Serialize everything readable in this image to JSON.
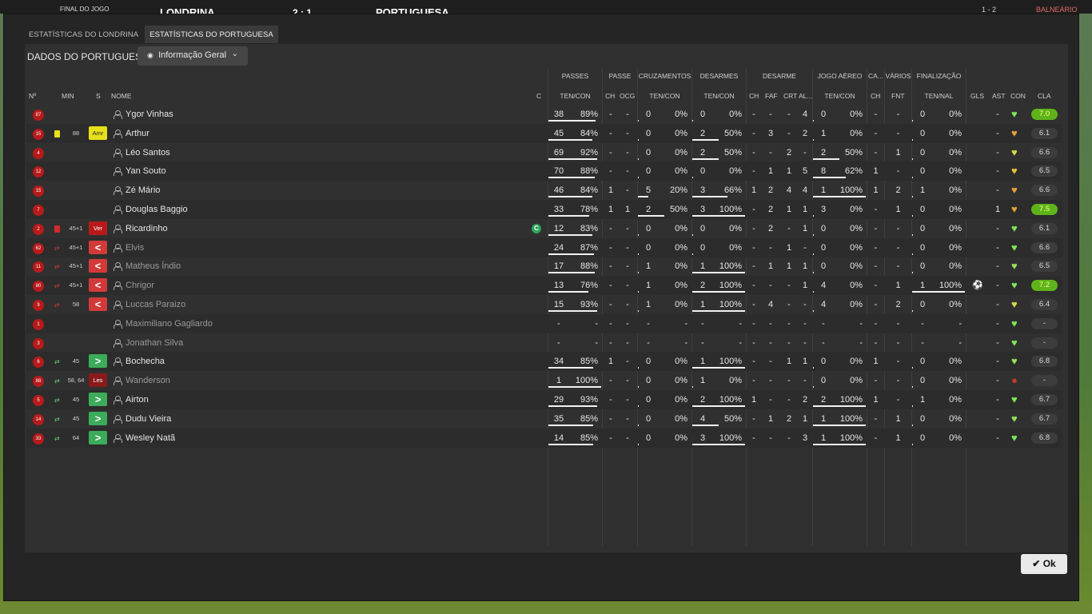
{
  "scorebar": {
    "status": "FINAL DO JOGO",
    "home": "LONDRINA",
    "score": "2 : 1",
    "away": "PORTUGUESA",
    "right1": "1 - 2",
    "right2": "BALNEÁRIO"
  },
  "tabs": [
    {
      "label": "ESTATÍSTICAS DO LONDRINA",
      "active": false
    },
    {
      "label": "ESTATÍSTICAS DO PORTUGUESA",
      "active": true
    }
  ],
  "header": {
    "title": "DADOS DO PORTUGUESA",
    "dropdown": "Informação Geral"
  },
  "groups": {
    "passes": "PASSES",
    "passe": "PASSE",
    "cruz": "CRUZAMENTOS",
    "desarmes": "DESARMES",
    "desarme": "DESARME",
    "jogo": "JOGO AÉREO",
    "ca": "CA...",
    "varios": "VÁRIOS",
    "final": "FINALIZAÇÃO"
  },
  "cols": {
    "no": "Nº",
    "min": "MIN",
    "s": "S",
    "nome": "NOME",
    "c": "C",
    "passes": "TEN/CON",
    "ch1": "CH",
    "ocg": "OCG",
    "cruz": "TEN/CON",
    "des": "TEN/CON",
    "ch2": "CH",
    "faf": "FAF",
    "crt": "CRT",
    "al": "AL...",
    "jogo": "TEN/CON",
    "ch3": "CH",
    "fnt": "FNT",
    "fin": "TEN/NAL",
    "gls": "GLS",
    "ast": "AST",
    "con": "CON",
    "cla": "CLA"
  },
  "captain_mark": "C",
  "players": [
    {
      "no": "87",
      "min": "",
      "s": "",
      "name": "Ygor Vinhas",
      "dim": false,
      "p": [
        "38",
        "89%"
      ],
      "pf": 0.89,
      "ch": "-",
      "ocg": "-",
      "cr": [
        "0",
        "0%"
      ],
      "crf": 0,
      "de": [
        "0",
        "0%"
      ],
      "def": 0,
      "dch": "-",
      "faf": "-",
      "crt": "-",
      "al": "4",
      "ja": [
        "0",
        "0%"
      ],
      "jaf": 0,
      "ca": "-",
      "fnt": "-",
      "fi": [
        "0",
        "0%"
      ],
      "fif": 0,
      "gls": "",
      "ast": "-",
      "con": "#7ee65a",
      "cla": "7.0",
      "claG": true
    },
    {
      "no": "15",
      "min": "88",
      "s": "Amr",
      "sType": "yellow",
      "card": "yellow",
      "name": "Arthur",
      "dim": false,
      "p": [
        "45",
        "84%"
      ],
      "pf": 0.84,
      "ch": "-",
      "ocg": "-",
      "cr": [
        "0",
        "0%"
      ],
      "crf": 0,
      "de": [
        "2",
        "50%"
      ],
      "def": 0.5,
      "dch": "-",
      "faf": "3",
      "crt": "-",
      "al": "2",
      "ja": [
        "1",
        "0%"
      ],
      "jaf": 0,
      "ca": "-",
      "fnt": "-",
      "fi": [
        "0",
        "0%"
      ],
      "fif": 0,
      "gls": "",
      "ast": "-",
      "con": "#e8a23a",
      "cla": "6.1",
      "claG": false
    },
    {
      "no": "4",
      "min": "",
      "s": "",
      "name": "Léo Santos",
      "dim": false,
      "p": [
        "69",
        "92%"
      ],
      "pf": 0.92,
      "ch": "-",
      "ocg": "-",
      "cr": [
        "0",
        "0%"
      ],
      "crf": 0,
      "de": [
        "2",
        "50%"
      ],
      "def": 0.5,
      "dch": "-",
      "faf": "-",
      "crt": "2",
      "al": "-",
      "ja": [
        "2",
        "50%"
      ],
      "jaf": 0.5,
      "ca": "-",
      "fnt": "1",
      "fi": [
        "0",
        "0%"
      ],
      "fif": 0,
      "gls": "",
      "ast": "-",
      "con": "#d8d94a",
      "cla": "6.6",
      "claG": false
    },
    {
      "no": "12",
      "min": "",
      "s": "",
      "name": "Yan Souto",
      "dim": false,
      "p": [
        "70",
        "88%"
      ],
      "pf": 0.88,
      "ch": "-",
      "ocg": "-",
      "cr": [
        "0",
        "0%"
      ],
      "crf": 0,
      "de": [
        "0",
        "0%"
      ],
      "def": 0,
      "dch": "-",
      "faf": "1",
      "crt": "1",
      "al": "5",
      "ja": [
        "8",
        "62%"
      ],
      "jaf": 0.62,
      "ca": "1",
      "fnt": "-",
      "fi": [
        "0",
        "0%"
      ],
      "fif": 0,
      "gls": "",
      "ast": "-",
      "con": "#e8c23a",
      "cla": "6.5",
      "claG": false
    },
    {
      "no": "15",
      "min": "",
      "s": "",
      "name": "Zé Mário",
      "dim": false,
      "p": [
        "46",
        "84%"
      ],
      "pf": 0.84,
      "ch": "1",
      "ocg": "-",
      "cr": [
        "5",
        "20%"
      ],
      "crf": 0.2,
      "de": [
        "3",
        "66%"
      ],
      "def": 0.66,
      "dch": "1",
      "faf": "2",
      "crt": "4",
      "al": "4",
      "ja": [
        "1",
        "100%"
      ],
      "jaf": 1,
      "ca": "1",
      "fnt": "2",
      "fi": [
        "1",
        "0%"
      ],
      "fif": 0,
      "gls": "",
      "ast": "-",
      "con": "#e8a23a",
      "cla": "6.6",
      "claG": false
    },
    {
      "no": "7",
      "min": "",
      "s": "",
      "name": "Douglas Baggio",
      "dim": false,
      "p": [
        "33",
        "78%"
      ],
      "pf": 0.78,
      "ch": "1",
      "ocg": "1",
      "cr": [
        "2",
        "50%"
      ],
      "crf": 0.5,
      "de": [
        "3",
        "100%"
      ],
      "def": 1,
      "dch": "-",
      "faf": "2",
      "crt": "1",
      "al": "1",
      "ja": [
        "3",
        "0%"
      ],
      "jaf": 0,
      "ca": "-",
      "fnt": "1",
      "fi": [
        "0",
        "0%"
      ],
      "fif": 0,
      "gls": "",
      "ast": "1",
      "con": "#e8a23a",
      "cla": "7.5",
      "claG": true
    },
    {
      "no": "2",
      "min": "45+1",
      "s": "Ver",
      "sType": "red",
      "card": "red",
      "name": "Ricardinho",
      "dim": false,
      "captain": true,
      "p": [
        "12",
        "83%"
      ],
      "pf": 0.83,
      "ch": "-",
      "ocg": "-",
      "cr": [
        "0",
        "0%"
      ],
      "crf": 0,
      "de": [
        "0",
        "0%"
      ],
      "def": 0,
      "dch": "-",
      "faf": "2",
      "crt": "-",
      "al": "1",
      "ja": [
        "0",
        "0%"
      ],
      "jaf": 0,
      "ca": "-",
      "fnt": "-",
      "fi": [
        "0",
        "0%"
      ],
      "fif": 0,
      "gls": "",
      "ast": "-",
      "con": "#7ee65a",
      "cla": "6.1",
      "claG": false
    },
    {
      "no": "62",
      "min": "45+1",
      "s": "<",
      "sType": "out",
      "card": "sub",
      "name": "Elvis",
      "dim": true,
      "p": [
        "24",
        "87%"
      ],
      "pf": 0.87,
      "ch": "-",
      "ocg": "-",
      "cr": [
        "0",
        "0%"
      ],
      "crf": 0,
      "de": [
        "0",
        "0%"
      ],
      "def": 0,
      "dch": "-",
      "faf": "-",
      "crt": "1",
      "al": "-",
      "ja": [
        "0",
        "0%"
      ],
      "jaf": 0,
      "ca": "-",
      "fnt": "-",
      "fi": [
        "0",
        "0%"
      ],
      "fif": 0,
      "gls": "",
      "ast": "-",
      "con": "#7ee65a",
      "cla": "6.6",
      "claG": false
    },
    {
      "no": "11",
      "min": "45+1",
      "s": "<",
      "sType": "out",
      "card": "sub",
      "name": "Matheus Índio",
      "dim": true,
      "p": [
        "17",
        "88%"
      ],
      "pf": 0.88,
      "ch": "-",
      "ocg": "-",
      "cr": [
        "1",
        "0%"
      ],
      "crf": 0,
      "de": [
        "1",
        "100%"
      ],
      "def": 1,
      "dch": "-",
      "faf": "1",
      "crt": "1",
      "al": "1",
      "ja": [
        "0",
        "0%"
      ],
      "jaf": 0,
      "ca": "-",
      "fnt": "-",
      "fi": [
        "0",
        "0%"
      ],
      "fif": 0,
      "gls": "",
      "ast": "-",
      "con": "#9ae05a",
      "cla": "6.5",
      "claG": false
    },
    {
      "no": "80",
      "min": "45+1",
      "s": "<",
      "sType": "out",
      "card": "sub",
      "name": "Chrigor",
      "dim": true,
      "p": [
        "13",
        "76%"
      ],
      "pf": 0.76,
      "ch": "-",
      "ocg": "-",
      "cr": [
        "1",
        "0%"
      ],
      "crf": 0,
      "de": [
        "2",
        "100%"
      ],
      "def": 1,
      "dch": "-",
      "faf": "-",
      "crt": "-",
      "al": "1",
      "ja": [
        "4",
        "0%"
      ],
      "jaf": 0,
      "ca": "-",
      "fnt": "1",
      "fi": [
        "1",
        "100%"
      ],
      "fif": 1,
      "gls": "⚽",
      "ast": "-",
      "con": "#7ee65a",
      "cla": "7.2",
      "claG": true
    },
    {
      "no": "9",
      "min": "58",
      "s": "<",
      "sType": "out",
      "card": "sub",
      "name": "Luccas Paraizo",
      "dim": true,
      "p": [
        "15",
        "93%"
      ],
      "pf": 0.93,
      "ch": "-",
      "ocg": "-",
      "cr": [
        "1",
        "0%"
      ],
      "crf": 0,
      "de": [
        "1",
        "100%"
      ],
      "def": 1,
      "dch": "-",
      "faf": "4",
      "crt": "-",
      "al": "-",
      "ja": [
        "4",
        "0%"
      ],
      "jaf": 0,
      "ca": "-",
      "fnt": "2",
      "fi": [
        "0",
        "0%"
      ],
      "fif": 0,
      "gls": "",
      "ast": "-",
      "con": "#d8d94a",
      "cla": "6.4",
      "claG": false
    },
    {
      "no": "1",
      "min": "",
      "s": "",
      "name": "Maximiliano Gagliardo",
      "dim": true,
      "p": [
        "-",
        "-"
      ],
      "pf": 0,
      "ch": "-",
      "ocg": "-",
      "cr": [
        "-",
        "-"
      ],
      "crf": 0,
      "de": [
        "-",
        "-"
      ],
      "def": 0,
      "dch": "-",
      "faf": "-",
      "crt": "-",
      "al": "-",
      "ja": [
        "-",
        "-"
      ],
      "jaf": 0,
      "ca": "-",
      "fnt": "-",
      "fi": [
        "-",
        "-"
      ],
      "fif": 0,
      "gls": "",
      "ast": "-",
      "con": "#7ee65a",
      "cla": "-",
      "claG": false
    },
    {
      "no": "3",
      "min": "",
      "s": "",
      "name": "Jonathan Silva",
      "dim": true,
      "p": [
        "-",
        "-"
      ],
      "pf": 0,
      "ch": "-",
      "ocg": "-",
      "cr": [
        "-",
        "-"
      ],
      "crf": 0,
      "de": [
        "-",
        "-"
      ],
      "def": 0,
      "dch": "-",
      "faf": "-",
      "crt": "-",
      "al": "-",
      "ja": [
        "-",
        "-"
      ],
      "jaf": 0,
      "ca": "-",
      "fnt": "-",
      "fi": [
        "-",
        "-"
      ],
      "fif": 0,
      "gls": "",
      "ast": "-",
      "con": "#7ee65a",
      "cla": "-",
      "claG": false
    },
    {
      "no": "6",
      "min": "45",
      "s": ">",
      "sType": "in",
      "card": "subin",
      "name": "Bochecha",
      "dim": false,
      "p": [
        "34",
        "85%"
      ],
      "pf": 0.85,
      "ch": "1",
      "ocg": "-",
      "cr": [
        "0",
        "0%"
      ],
      "crf": 0,
      "de": [
        "1",
        "100%"
      ],
      "def": 1,
      "dch": "-",
      "faf": "-",
      "crt": "1",
      "al": "1",
      "ja": [
        "0",
        "0%"
      ],
      "jaf": 0,
      "ca": "1",
      "fnt": "-",
      "fi": [
        "0",
        "0%"
      ],
      "fif": 0,
      "gls": "",
      "ast": "-",
      "con": "#9ae05a",
      "cla": "6.8",
      "claG": false
    },
    {
      "no": "88",
      "min": "58, 64",
      "s": "Les",
      "sType": "les",
      "card": "subin",
      "name": "Wanderson",
      "dim": true,
      "p": [
        "1",
        "100%"
      ],
      "pf": 1,
      "ch": "-",
      "ocg": "-",
      "cr": [
        "0",
        "0%"
      ],
      "crf": 0,
      "de": [
        "1",
        "0%"
      ],
      "def": 0,
      "dch": "-",
      "faf": "-",
      "crt": "-",
      "al": "-",
      "ja": [
        "0",
        "0%"
      ],
      "jaf": 0,
      "ca": "-",
      "fnt": "-",
      "fi": [
        "0",
        "0%"
      ],
      "fif": 0,
      "gls": "",
      "ast": "-",
      "con": "#c0392b",
      "cla": "-",
      "claG": false
    },
    {
      "no": "5",
      "min": "45",
      "s": ">",
      "sType": "in",
      "card": "subin",
      "name": "Airton",
      "dim": false,
      "p": [
        "29",
        "93%"
      ],
      "pf": 0.93,
      "ch": "-",
      "ocg": "-",
      "cr": [
        "0",
        "0%"
      ],
      "crf": 0,
      "de": [
        "2",
        "100%"
      ],
      "def": 1,
      "dch": "1",
      "faf": "-",
      "crt": "-",
      "al": "2",
      "ja": [
        "2",
        "100%"
      ],
      "jaf": 1,
      "ca": "1",
      "fnt": "-",
      "fi": [
        "1",
        "0%"
      ],
      "fif": 0,
      "gls": "",
      "ast": "-",
      "con": "#7ee65a",
      "cla": "6.7",
      "claG": false
    },
    {
      "no": "14",
      "min": "45",
      "s": ">",
      "sType": "in",
      "card": "subin",
      "name": "Dudu Vieira",
      "dim": false,
      "p": [
        "35",
        "85%"
      ],
      "pf": 0.85,
      "ch": "-",
      "ocg": "-",
      "cr": [
        "0",
        "0%"
      ],
      "crf": 0,
      "de": [
        "4",
        "50%"
      ],
      "def": 0.5,
      "dch": "-",
      "faf": "1",
      "crt": "2",
      "al": "1",
      "ja": [
        "1",
        "100%"
      ],
      "jaf": 1,
      "ca": "-",
      "fnt": "1",
      "fi": [
        "0",
        "0%"
      ],
      "fif": 0,
      "gls": "",
      "ast": "-",
      "con": "#9ae05a",
      "cla": "6.7",
      "claG": false
    },
    {
      "no": "33",
      "min": "64",
      "s": ">",
      "sType": "in",
      "card": "subin",
      "name": "Wesley Natã",
      "dim": false,
      "p": [
        "14",
        "85%"
      ],
      "pf": 0.85,
      "ch": "-",
      "ocg": "-",
      "cr": [
        "0",
        "0%"
      ],
      "crf": 0,
      "de": [
        "3",
        "100%"
      ],
      "def": 1,
      "dch": "-",
      "faf": "-",
      "crt": "-",
      "al": "3",
      "ja": [
        "1",
        "100%"
      ],
      "jaf": 1,
      "ca": "-",
      "fnt": "1",
      "fi": [
        "0",
        "0%"
      ],
      "fif": 0,
      "gls": "",
      "ast": "-",
      "con": "#7ee65a",
      "cla": "6.8",
      "claG": false
    }
  ],
  "ok_button": "Ok",
  "colors": {
    "accent_green": "#5fb31a",
    "badge_red": "#b81a1a",
    "yellow": "#e8e01a",
    "sub_in": "#3cab5a",
    "sub_out": "#d23a3a"
  }
}
